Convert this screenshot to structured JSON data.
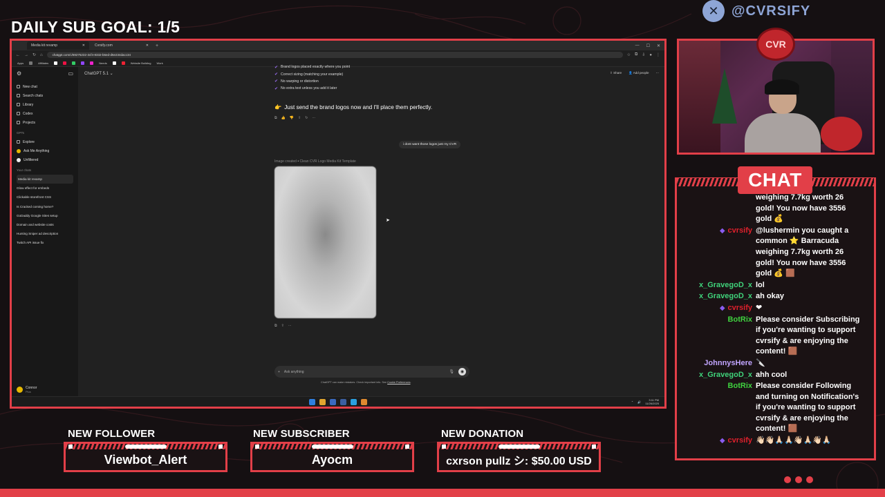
{
  "overlay": {
    "goal_text": "DAILY SUB GOAL: 1/5",
    "handle_icon": "x-logo-icon",
    "handle": "@CVRSIFY",
    "chat_title": "CHAT",
    "colors": {
      "accent": "#e23f48",
      "background": "#151012",
      "handle": "#8ea5d6"
    }
  },
  "alerts": {
    "follower": {
      "title": "NEW FOLLOWER",
      "value": "Viewbot_Alert"
    },
    "subscriber": {
      "title": "NEW SUBSCRIBER",
      "value": "Ayocm"
    },
    "donation": {
      "title": "NEW DONATION",
      "value": "cxrson pullz シ: $50.00 USD"
    }
  },
  "chat": [
    {
      "name": "",
      "color": "#ffffff",
      "text": "weighing 7.7kg worth 26 gold! You now have 3556 gold 💰"
    },
    {
      "name": "cvrsify",
      "color": "#e0202c",
      "badge": true,
      "text": "@lushermin you caught a common ⭐ Barracuda weighing 7.7kg worth 26 gold! You now have 3556 gold 💰 🟫"
    },
    {
      "name": "x_GravegoD_x",
      "color": "#3fd27a",
      "text": "lol"
    },
    {
      "name": "x_GravegoD_x",
      "color": "#3fd27a",
      "text": "ah okay"
    },
    {
      "name": "cvrsify",
      "color": "#e0202c",
      "badge": true,
      "text": "❤"
    },
    {
      "name": "BotRix",
      "color": "#3fd23f",
      "text": "Please consider Subscribing if you're wanting to support cvrsify & are enjoying the content! 🟫"
    },
    {
      "name": "JohnnysHere",
      "color": "#c2a5ff",
      "text": "🔪"
    },
    {
      "name": "x_GravegoD_x",
      "color": "#3fd27a",
      "text": "ahh cool"
    },
    {
      "name": "BotRix",
      "color": "#3fd23f",
      "text": "Please consider Following and turning on Notification's if you're wanting to support cvrsify & are enjoying the content! 🟫"
    },
    {
      "name": "cvrsify",
      "color": "#e0202c",
      "badge": true,
      "text": "👋🏻👋🏻🙏🏻🙏🏻👋🏻🙏🏻👋🏻🙏🏻"
    }
  ],
  "browser": {
    "tabs": [
      "Media kit revamp",
      "Cvrsify.com"
    ],
    "address": "chatgpt.com/c/69275232-3cf4-8332-b6ed-d5e234dacc34",
    "bookmarks": [
      "Apps",
      "Affiliates",
      "Needs",
      "Website Building",
      "Work"
    ]
  },
  "chatgpt": {
    "model": "ChatGPT 5.1",
    "share": "Share",
    "add_people": "Add people",
    "sidebar": {
      "items": [
        "New chat",
        "Search chats",
        "Library",
        "Codex",
        "Projects"
      ],
      "gpts_label": "GPTs",
      "gpts": [
        "Explore",
        "Ask Me Anything",
        "Unfiltered"
      ],
      "chats_label": "Your chats",
      "chats": [
        "Media kit revamp",
        "Glow effect for embeds",
        "Clickable storefront CSS",
        "Is Cracked coming home?",
        "GoDaddy Google Sites setup",
        "Domain and website costs",
        "Hunting Sniper ad description",
        "Twitch API issue fix"
      ],
      "user": "Connor",
      "user_plan": "Plus"
    },
    "checklist": [
      "Brand logos placed exactly where you point",
      "Correct sizing (matching your example)",
      "No warping or distortion",
      "No extra text unless you add it later"
    ],
    "headline": "Just send the brand logos now and I'll place them perfectly.",
    "user_message": "i dont want those logos just my CVR",
    "image_label": "Image created",
    "image_title": "Clean CVR Logo Media Kit Template",
    "composer_placeholder": "Ask anything",
    "disclaimer": "ChatGPT can make mistakes. Check important info. See",
    "disclaimer_link": "Cookie Preferences",
    "clock": "3:11 PM",
    "date": "11/26/2025"
  }
}
